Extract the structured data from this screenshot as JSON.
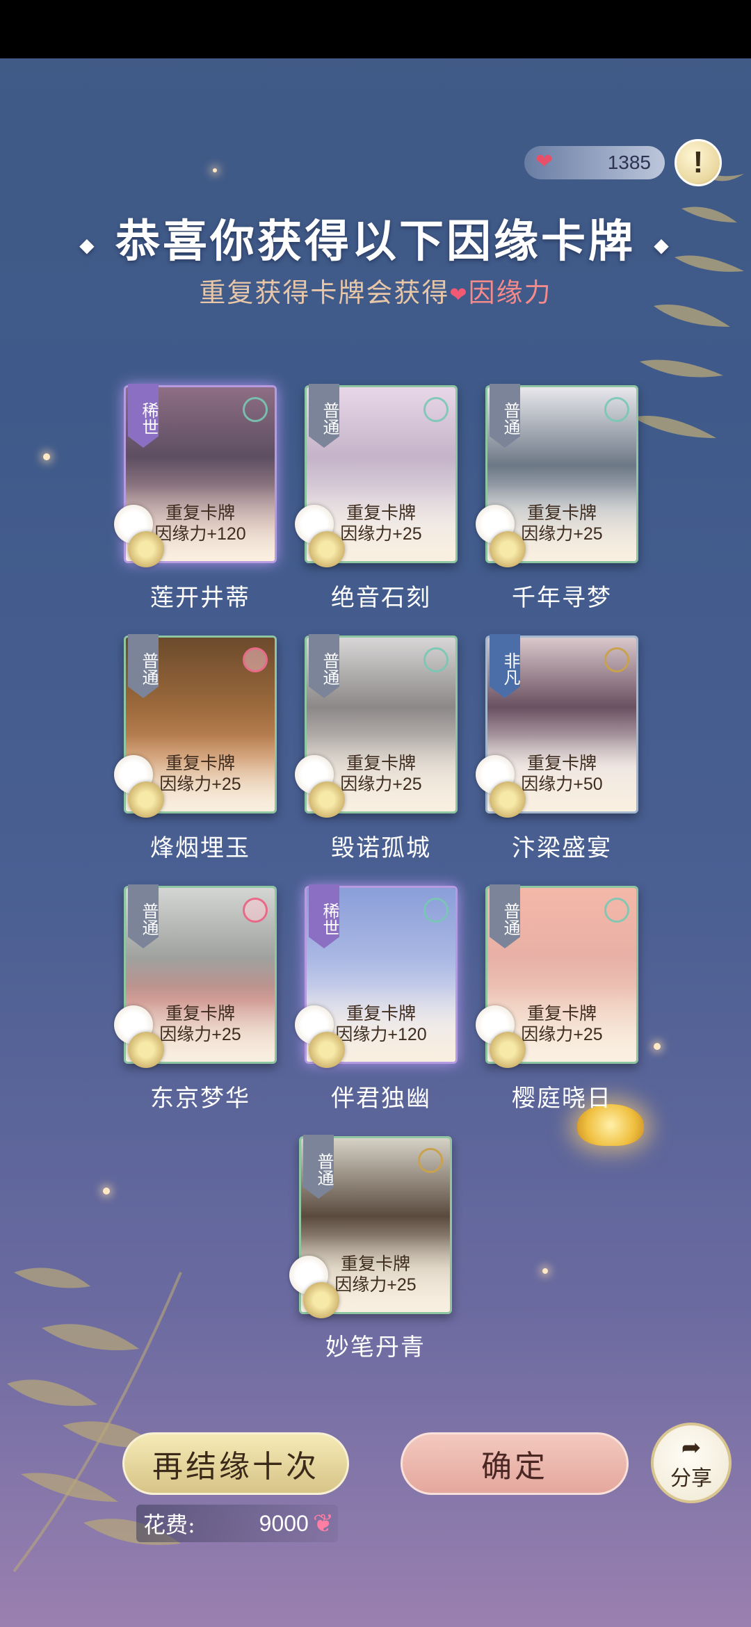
{
  "header": {
    "currency_value": "1385",
    "info_icon": "exclamation-icon",
    "title": "恭喜你获得以下因缘卡牌",
    "title_deco_left": "◆",
    "title_deco_right": "◆",
    "subtitle_prefix": "重复获得卡牌会获得",
    "subtitle_highlight": "因缘力"
  },
  "cards": [
    {
      "rarity": "稀世",
      "name": "莲开井蒂",
      "dup_label": "重复卡牌",
      "bonus": "因缘力+120"
    },
    {
      "rarity": "普通",
      "name": "绝音石刻",
      "dup_label": "重复卡牌",
      "bonus": "因缘力+25"
    },
    {
      "rarity": "普通",
      "name": "千年寻梦",
      "dup_label": "重复卡牌",
      "bonus": "因缘力+25"
    },
    {
      "rarity": "普通",
      "name": "烽烟埋玉",
      "dup_label": "重复卡牌",
      "bonus": "因缘力+25"
    },
    {
      "rarity": "普通",
      "name": "毁诺孤城",
      "dup_label": "重复卡牌",
      "bonus": "因缘力+25"
    },
    {
      "rarity": "非凡",
      "name": "汴梁盛宴",
      "dup_label": "重复卡牌",
      "bonus": "因缘力+50"
    },
    {
      "rarity": "普通",
      "name": "东京梦华",
      "dup_label": "重复卡牌",
      "bonus": "因缘力+25"
    },
    {
      "rarity": "稀世",
      "name": "伴君独幽",
      "dup_label": "重复卡牌",
      "bonus": "因缘力+120"
    },
    {
      "rarity": "普通",
      "name": "樱庭晓日",
      "dup_label": "重复卡牌",
      "bonus": "因缘力+25"
    },
    {
      "rarity": "普通",
      "name": "妙笔丹青",
      "dup_label": "重复卡牌",
      "bonus": "因缘力+25"
    }
  ],
  "footer": {
    "again_label": "再结缘十次",
    "confirm_label": "确定",
    "share_label": "分享",
    "cost_label": "花费:",
    "cost_value": "9000"
  },
  "colors": {
    "background": "#415a86",
    "title": "#ffffff",
    "subtitle": "#e7c7a8",
    "highlight": "#f48a8a"
  }
}
